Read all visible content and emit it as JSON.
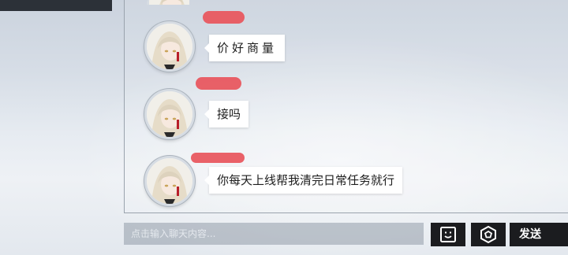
{
  "chat": {
    "messages": [
      {
        "sender_name_visible": false,
        "text": "价好商量"
      },
      {
        "sender_name_visible": false,
        "text": "接吗"
      },
      {
        "sender_name_visible": false,
        "text": "你每天上线帮我清完日常任务就行"
      }
    ],
    "sender_name_color": "#e8555c"
  },
  "composer": {
    "placeholder": "点击输入聊天内容...",
    "emoji_icon": "emoji-face-icon",
    "extra_icon": "hexagon-target-icon",
    "send_label": "发送"
  },
  "colors": {
    "button_bg": "#1b1c1f",
    "bubble_bg": "#ffffff",
    "panel_border": "#9aa3ad"
  }
}
